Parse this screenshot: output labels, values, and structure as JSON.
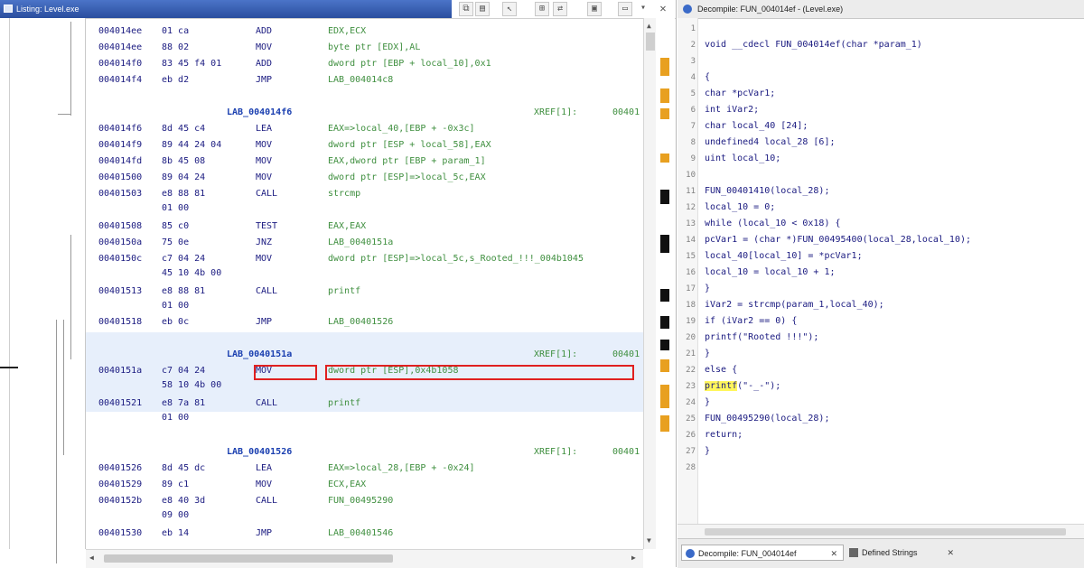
{
  "listing": {
    "title": "Listing: Level.exe",
    "toolbar_icons": [
      "copy-icon",
      "paste-icon",
      "cursor-icon",
      "filter-icon",
      "export-icon",
      "print-icon",
      "save-icon",
      "menu-icon",
      "close-icon"
    ],
    "rows": [
      {
        "addr": "004014ee",
        "bytes": "01 ca",
        "mn": "ADD",
        "ops": "EDX,ECX"
      },
      {
        "addr": "004014ee",
        "bytes": "88 02",
        "mn": "MOV",
        "ops": "byte ptr [EDX],AL"
      },
      {
        "addr": "004014f0",
        "bytes": "83 45 f4 01",
        "mn": "ADD",
        "ops": "dword ptr [EBP + local_10],0x1"
      },
      {
        "addr": "004014f4",
        "bytes": "eb d2",
        "mn": "JMP",
        "ops": "LAB_004014c8"
      },
      {
        "label": "LAB_004014f6",
        "xref": "XREF[1]:",
        "xref2": "00401"
      },
      {
        "addr": "004014f6",
        "bytes": "8d 45 c4",
        "mn": "LEA",
        "ops": "EAX=>local_40,[EBP + -0x3c]"
      },
      {
        "addr": "004014f9",
        "bytes": "89 44 24 04",
        "mn": "MOV",
        "ops": "dword ptr [ESP + local_58],EAX"
      },
      {
        "addr": "004014fd",
        "bytes": "8b 45 08",
        "mn": "MOV",
        "ops": "EAX,dword ptr [EBP + param_1]"
      },
      {
        "addr": "00401500",
        "bytes": "89 04 24",
        "mn": "MOV",
        "ops": "dword ptr [ESP]=>local_5c,EAX"
      },
      {
        "addr": "00401503",
        "bytes": "e8 88 81",
        "mn": "CALL",
        "ops": "strcmp"
      },
      {
        "bytes": "01 00"
      },
      {
        "addr": "00401508",
        "bytes": "85 c0",
        "mn": "TEST",
        "ops": "EAX,EAX"
      },
      {
        "addr": "0040150a",
        "bytes": "75 0e",
        "mn": "JNZ",
        "ops": "LAB_0040151a"
      },
      {
        "addr": "0040150c",
        "bytes": "c7 04 24",
        "mn": "MOV",
        "ops": "dword ptr [ESP]=>local_5c,s_Rooted_!!!_004b1045"
      },
      {
        "bytes": "45 10 4b 00"
      },
      {
        "addr": "00401513",
        "bytes": "e8 88 81",
        "mn": "CALL",
        "ops": "printf"
      },
      {
        "bytes": "01 00"
      },
      {
        "addr": "00401518",
        "bytes": "eb 0c",
        "mn": "JMP",
        "ops": "LAB_00401526"
      },
      {
        "label": "LAB_0040151a",
        "xref": "XREF[1]:",
        "xref2": "00401"
      },
      {
        "addr": "0040151a",
        "bytes": "c7 04 24",
        "mn": "MOV",
        "ops": "dword ptr [ESP],0x4b1058"
      },
      {
        "bytes": "58 10 4b 00"
      },
      {
        "addr": "00401521",
        "bytes": "e8 7a 81",
        "mn": "CALL",
        "ops": "printf"
      },
      {
        "bytes": "01 00"
      },
      {
        "label": "LAB_00401526",
        "xref": "XREF[1]:",
        "xref2": "00401"
      },
      {
        "addr": "00401526",
        "bytes": "8d 45 dc",
        "mn": "LEA",
        "ops": "EAX=>local_28,[EBP + -0x24]"
      },
      {
        "addr": "00401529",
        "bytes": "89 c1",
        "mn": "MOV",
        "ops": "ECX,EAX"
      },
      {
        "addr": "0040152b",
        "bytes": "e8 40 3d",
        "mn": "CALL",
        "ops": "FUN_00495290"
      },
      {
        "bytes": "09 00"
      },
      {
        "addr": "00401530",
        "bytes": "eb 14",
        "mn": "JMP",
        "ops": "LAB_00401546"
      }
    ]
  },
  "decompiler": {
    "title": "Decompile: FUN_004014ef - (Level.exe)",
    "line_numbers": [
      "1",
      "2",
      "3",
      "4",
      "5",
      "6",
      "7",
      "8",
      "9",
      "10",
      "11",
      "12",
      "13",
      "14",
      "15",
      "16",
      "17",
      "18",
      "19",
      "20",
      "21",
      "22",
      "23",
      "24",
      "25",
      "26",
      "27",
      "28"
    ],
    "lines": [
      "",
      "void __cdecl FUN_004014ef(char *param_1)",
      "",
      "{",
      "  char *pcVar1;",
      "  int iVar2;",
      "  char local_40 [24];",
      "  undefined4 local_28 [6];",
      "  uint local_10;",
      "",
      "  FUN_00401410(local_28);",
      "  local_10 = 0;",
      "  while (local_10 < 0x18) {",
      "    pcVar1 = (char *)FUN_00495400(local_28,local_10);",
      "    local_40[local_10] = *pcVar1;",
      "    local_10 = local_10 + 1;",
      "  }",
      "  iVar2 = strcmp(param_1,local_40);",
      "  if (iVar2 == 0) {",
      "    printf(\"Rooted !!!\");",
      "  }",
      "  else {",
      "    printf(\"-_-\");",
      "  }",
      "  FUN_00495290(local_28);",
      "  return;",
      "}",
      ""
    ]
  },
  "tabs": {
    "decompile_label": "Decompile: FUN_004014ef",
    "strings_label": "Defined Strings"
  },
  "colors": {
    "title_blue": "#2a4e9e",
    "highlight_row": "#e7effb",
    "red_box": "#e02020",
    "marker_orange": "#e8a020",
    "marker_black": "#111111",
    "printf_highlight": "#fff65c"
  }
}
